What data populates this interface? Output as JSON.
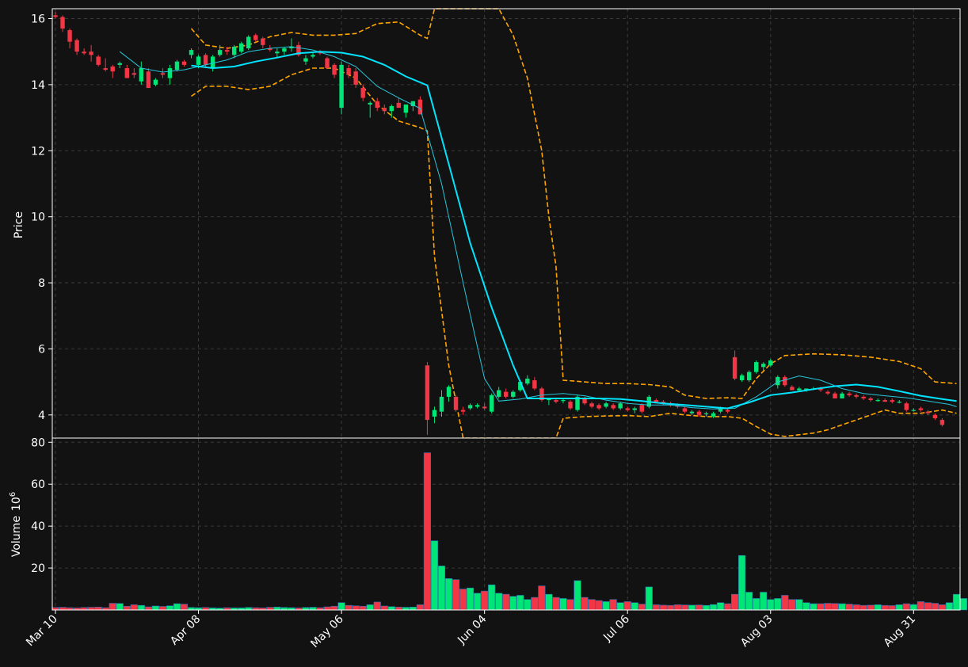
{
  "chart_data": {
    "type": "candlestick",
    "price_panel": {
      "ylabel": "Price",
      "ylim": [
        3.3,
        16.3
      ],
      "yticks": [
        "4",
        "6",
        "8",
        "10",
        "12",
        "14",
        "16"
      ],
      "grid": true
    },
    "volume_panel": {
      "ylabel": "Volume",
      "ylabel_exp": "10",
      "ylabel_sup": "6",
      "ylim": [
        0,
        82
      ],
      "yticks": [
        "20",
        "40",
        "60",
        "80"
      ],
      "grid": true
    },
    "x_range": [
      0,
      126.5
    ],
    "xticks": [
      {
        "label": "Mar 10",
        "index": 0
      },
      {
        "label": "Apr 08",
        "index": 20
      },
      {
        "label": "May 06",
        "index": 40
      },
      {
        "label": "Jun 04",
        "index": 60
      },
      {
        "label": "Jul 06",
        "index": 80
      },
      {
        "label": "Aug 03",
        "index": 100
      },
      {
        "label": "Aug 31",
        "index": 120
      }
    ],
    "colors": {
      "up": "#00e676",
      "down": "#f23645",
      "ma_fast": "#26c6da",
      "ma_slow": "#00e5ff",
      "band": "#ffa500",
      "background": "#121212",
      "grid": "#3a3a3a"
    },
    "candles": [
      [
        16.1,
        16.2,
        16.0,
        16.05
      ],
      [
        16.05,
        16.1,
        15.6,
        15.7
      ],
      [
        15.65,
        15.7,
        15.1,
        15.3
      ],
      [
        15.35,
        15.4,
        14.9,
        15.0
      ],
      [
        15.0,
        15.1,
        14.9,
        14.95
      ],
      [
        15.0,
        15.2,
        14.7,
        14.9
      ],
      [
        14.85,
        14.9,
        14.55,
        14.6
      ],
      [
        14.5,
        14.8,
        14.4,
        14.45
      ],
      [
        14.55,
        14.6,
        14.2,
        14.4
      ],
      [
        14.6,
        14.7,
        14.5,
        14.65
      ],
      [
        14.5,
        14.6,
        14.2,
        14.2
      ],
      [
        14.35,
        14.5,
        14.2,
        14.3
      ],
      [
        14.1,
        14.7,
        14.0,
        14.5
      ],
      [
        14.4,
        14.5,
        13.9,
        13.9
      ],
      [
        14.0,
        14.2,
        13.95,
        14.15
      ],
      [
        14.35,
        14.5,
        14.2,
        14.3
      ],
      [
        14.2,
        14.6,
        14.0,
        14.5
      ],
      [
        14.45,
        14.75,
        14.4,
        14.7
      ],
      [
        14.7,
        14.75,
        14.55,
        14.6
      ],
      [
        14.9,
        15.1,
        14.8,
        15.05
      ],
      [
        14.6,
        14.9,
        14.5,
        14.85
      ],
      [
        14.9,
        14.95,
        14.5,
        14.6
      ],
      [
        14.5,
        14.9,
        14.4,
        14.85
      ],
      [
        14.9,
        15.2,
        14.85,
        15.05
      ],
      [
        15.05,
        15.15,
        14.9,
        15.0
      ],
      [
        14.9,
        15.2,
        14.8,
        15.15
      ],
      [
        15.0,
        15.3,
        14.95,
        15.25
      ],
      [
        15.1,
        15.5,
        15.05,
        15.45
      ],
      [
        15.5,
        15.55,
        15.3,
        15.35
      ],
      [
        15.4,
        15.45,
        15.1,
        15.2
      ],
      [
        15.1,
        15.2,
        15.0,
        15.05
      ],
      [
        14.95,
        15.1,
        14.8,
        15.0
      ],
      [
        15.0,
        15.15,
        14.9,
        15.1
      ],
      [
        15.1,
        15.4,
        15.0,
        15.15
      ],
      [
        15.2,
        15.3,
        14.85,
        14.9
      ],
      [
        14.7,
        14.9,
        14.6,
        14.8
      ],
      [
        14.85,
        15.0,
        14.8,
        14.9
      ],
      [
        15.0,
        15.05,
        14.9,
        14.95
      ],
      [
        14.8,
        14.85,
        14.5,
        14.5
      ],
      [
        14.6,
        14.65,
        14.2,
        14.3
      ],
      [
        13.3,
        14.7,
        13.1,
        14.6
      ],
      [
        14.5,
        14.6,
        14.2,
        14.3
      ],
      [
        14.4,
        14.5,
        13.9,
        14.0
      ],
      [
        13.9,
        14.0,
        13.5,
        13.6
      ],
      [
        13.4,
        13.5,
        13.0,
        13.45
      ],
      [
        13.5,
        13.6,
        13.2,
        13.3
      ],
      [
        13.3,
        13.4,
        13.1,
        13.2
      ],
      [
        13.2,
        13.4,
        13.0,
        13.35
      ],
      [
        13.45,
        13.6,
        13.3,
        13.3
      ],
      [
        13.15,
        13.4,
        13.0,
        13.4
      ],
      [
        13.35,
        13.5,
        13.2,
        13.5
      ],
      [
        13.55,
        13.65,
        13.1,
        13.1
      ],
      [
        5.5,
        5.6,
        3.4,
        3.85
      ],
      [
        3.95,
        4.25,
        3.75,
        4.15
      ],
      [
        4.1,
        4.75,
        3.95,
        4.55
      ],
      [
        4.55,
        4.9,
        4.4,
        4.85
      ],
      [
        4.55,
        4.6,
        4.1,
        4.15
      ],
      [
        4.15,
        4.25,
        4.0,
        4.1
      ],
      [
        4.2,
        4.35,
        4.15,
        4.3
      ],
      [
        4.25,
        4.35,
        4.2,
        4.3
      ],
      [
        4.25,
        4.35,
        4.15,
        4.2
      ],
      [
        4.1,
        4.65,
        4.05,
        4.6
      ],
      [
        4.55,
        4.85,
        4.5,
        4.75
      ],
      [
        4.7,
        4.8,
        4.5,
        4.55
      ],
      [
        4.55,
        4.75,
        4.5,
        4.7
      ],
      [
        4.75,
        5.05,
        4.7,
        5.0
      ],
      [
        4.95,
        5.2,
        4.9,
        5.1
      ],
      [
        5.05,
        5.15,
        4.75,
        4.8
      ],
      [
        4.8,
        4.85,
        4.4,
        4.45
      ],
      [
        4.45,
        4.5,
        4.3,
        4.5
      ],
      [
        4.45,
        4.5,
        4.35,
        4.4
      ],
      [
        4.45,
        4.5,
        4.35,
        4.45
      ],
      [
        4.4,
        4.45,
        4.15,
        4.2
      ],
      [
        4.15,
        4.6,
        4.1,
        4.55
      ],
      [
        4.5,
        4.55,
        4.3,
        4.35
      ],
      [
        4.35,
        4.4,
        4.2,
        4.25
      ],
      [
        4.3,
        4.35,
        4.15,
        4.2
      ],
      [
        4.25,
        4.4,
        4.2,
        4.35
      ],
      [
        4.3,
        4.35,
        4.15,
        4.2
      ],
      [
        4.2,
        4.4,
        4.15,
        4.35
      ],
      [
        4.2,
        4.25,
        4.1,
        4.15
      ],
      [
        4.15,
        4.25,
        4.05,
        4.2
      ],
      [
        4.3,
        4.35,
        4.05,
        4.1
      ],
      [
        4.25,
        4.6,
        4.2,
        4.55
      ],
      [
        4.45,
        4.5,
        4.35,
        4.4
      ],
      [
        4.4,
        4.45,
        4.3,
        4.35
      ],
      [
        4.35,
        4.4,
        4.25,
        4.3
      ],
      [
        4.3,
        4.35,
        4.2,
        4.25
      ],
      [
        4.2,
        4.25,
        4.05,
        4.1
      ],
      [
        4.05,
        4.15,
        4.0,
        4.1
      ],
      [
        4.1,
        4.15,
        3.95,
        4.0
      ],
      [
        4.05,
        4.1,
        3.95,
        4.05
      ],
      [
        3.95,
        4.1,
        3.9,
        4.05
      ],
      [
        4.1,
        4.25,
        4.05,
        4.2
      ],
      [
        4.15,
        4.2,
        4.05,
        4.1
      ],
      [
        5.75,
        5.95,
        5.05,
        5.1
      ],
      [
        5.05,
        5.25,
        5.0,
        5.2
      ],
      [
        5.05,
        5.35,
        5.0,
        5.3
      ],
      [
        5.3,
        5.65,
        5.25,
        5.6
      ],
      [
        5.45,
        5.6,
        5.35,
        5.55
      ],
      [
        5.5,
        5.7,
        5.45,
        5.65
      ],
      [
        4.9,
        5.2,
        4.8,
        5.15
      ],
      [
        5.15,
        5.2,
        4.85,
        4.9
      ],
      [
        4.85,
        4.9,
        4.75,
        4.75
      ],
      [
        4.75,
        4.85,
        4.7,
        4.8
      ],
      [
        4.75,
        4.8,
        4.7,
        4.8
      ],
      [
        4.8,
        4.85,
        4.75,
        4.8
      ],
      [
        4.8,
        4.85,
        4.7,
        4.75
      ],
      [
        4.7,
        4.75,
        4.6,
        4.65
      ],
      [
        4.65,
        4.7,
        4.5,
        4.5
      ],
      [
        4.5,
        4.7,
        4.5,
        4.65
      ],
      [
        4.65,
        4.7,
        4.55,
        4.6
      ],
      [
        4.6,
        4.65,
        4.5,
        4.55
      ],
      [
        4.55,
        4.6,
        4.45,
        4.5
      ],
      [
        4.5,
        4.55,
        4.4,
        4.45
      ],
      [
        4.45,
        4.5,
        4.4,
        4.45
      ],
      [
        4.45,
        4.5,
        4.4,
        4.4
      ],
      [
        4.45,
        4.5,
        4.35,
        4.4
      ],
      [
        4.4,
        4.45,
        4.35,
        4.4
      ],
      [
        4.35,
        4.4,
        4.1,
        4.15
      ],
      [
        4.15,
        4.2,
        4.1,
        4.15
      ],
      [
        4.2,
        4.25,
        4.1,
        4.15
      ],
      [
        4.1,
        4.15,
        4.0,
        4.05
      ],
      [
        4.0,
        4.05,
        3.85,
        3.9
      ],
      [
        3.85,
        3.9,
        3.65,
        3.7
      ]
    ],
    "volume": [
      1.2,
      1.3,
      1.1,
      1.0,
      1.2,
      1.3,
      1.4,
      1.1,
      3.2,
      3.1,
      1.8,
      2.5,
      2.2,
      1.5,
      1.9,
      1.7,
      2.0,
      3.0,
      2.8,
      1.2,
      1.1,
      1.2,
      1.0,
      0.9,
      1.1,
      1.0,
      1.0,
      1.2,
      1.1,
      1.0,
      1.3,
      1.4,
      1.2,
      1.1,
      1.0,
      1.2,
      1.3,
      1.1,
      1.5,
      1.8,
      3.5,
      2.2,
      2.0,
      1.8,
      2.5,
      3.8,
      1.9,
      1.6,
      1.4,
      1.3,
      1.4,
      2.5,
      75.0,
      33.0,
      21.0,
      15.0,
      14.5,
      10.0,
      10.5,
      8.0,
      9.0,
      12.0,
      8.0,
      7.5,
      6.5,
      7.0,
      5.0,
      6.0,
      11.5,
      7.5,
      6.0,
      5.5,
      5.0,
      14.0,
      6.0,
      5.0,
      4.5,
      4.0,
      5.0,
      3.5,
      4.0,
      3.5,
      2.8,
      11.0,
      2.5,
      2.3,
      2.2,
      2.5,
      2.4,
      2.3,
      2.4,
      2.2,
      2.6,
      3.5,
      3.0,
      7.5,
      26.0,
      8.5,
      5.5,
      8.5,
      5.0,
      5.5,
      7.0,
      5.0,
      5.0,
      3.5,
      3.0,
      3.0,
      3.2,
      3.1,
      3.0,
      2.8,
      2.5,
      2.2,
      2.3,
      2.5,
      2.2,
      2.1,
      2.5,
      3.0,
      2.6,
      4.0,
      3.5,
      3.2,
      2.5,
      3.5,
      7.5,
      5.5
    ],
    "ma_fast": [
      [
        9,
        15.0
      ],
      [
        12,
        14.5
      ],
      [
        15,
        14.38
      ],
      [
        18,
        14.45
      ],
      [
        21,
        14.6
      ],
      [
        24,
        14.75
      ],
      [
        27,
        15.0
      ],
      [
        30,
        15.1
      ],
      [
        33,
        15.15
      ],
      [
        36,
        15.05
      ],
      [
        39,
        14.85
      ],
      [
        42,
        14.55
      ],
      [
        45,
        13.95
      ],
      [
        48,
        13.6
      ],
      [
        51,
        13.28
      ],
      [
        54,
        11.0
      ],
      [
        57,
        8.0
      ],
      [
        60,
        5.1
      ],
      [
        62,
        4.42
      ],
      [
        65,
        4.48
      ],
      [
        68,
        4.6
      ],
      [
        71,
        4.65
      ],
      [
        74,
        4.58
      ],
      [
        77,
        4.45
      ],
      [
        80,
        4.35
      ],
      [
        83,
        4.3
      ],
      [
        86,
        4.3
      ],
      [
        89,
        4.22
      ],
      [
        92,
        4.18
      ],
      [
        95,
        4.2
      ],
      [
        98,
        4.55
      ],
      [
        101,
        5.0
      ],
      [
        104,
        5.18
      ],
      [
        107,
        5.05
      ],
      [
        110,
        4.8
      ],
      [
        113,
        4.65
      ],
      [
        116,
        4.58
      ],
      [
        119,
        4.52
      ],
      [
        122,
        4.42
      ],
      [
        125,
        4.32
      ],
      [
        126,
        4.25
      ]
    ],
    "ma_slow": [
      [
        19,
        14.58
      ],
      [
        22,
        14.5
      ],
      [
        25,
        14.55
      ],
      [
        28,
        14.7
      ],
      [
        31,
        14.82
      ],
      [
        34,
        14.95
      ],
      [
        37,
        15.0
      ],
      [
        40,
        14.97
      ],
      [
        43,
        14.85
      ],
      [
        46,
        14.6
      ],
      [
        49,
        14.25
      ],
      [
        52,
        13.98
      ],
      [
        55,
        11.6
      ],
      [
        58,
        9.2
      ],
      [
        61,
        7.25
      ],
      [
        64,
        5.5
      ],
      [
        66,
        4.5
      ],
      [
        70,
        4.5
      ],
      [
        73,
        4.5
      ],
      [
        76,
        4.5
      ],
      [
        79,
        4.48
      ],
      [
        82,
        4.42
      ],
      [
        85,
        4.35
      ],
      [
        88,
        4.3
      ],
      [
        91,
        4.25
      ],
      [
        94,
        4.2
      ],
      [
        97,
        4.38
      ],
      [
        100,
        4.6
      ],
      [
        103,
        4.68
      ],
      [
        106,
        4.78
      ],
      [
        109,
        4.87
      ],
      [
        112,
        4.92
      ],
      [
        115,
        4.85
      ],
      [
        118,
        4.72
      ],
      [
        121,
        4.58
      ],
      [
        124,
        4.48
      ],
      [
        126,
        4.42
      ]
    ],
    "band_upper": [
      [
        19,
        15.7
      ],
      [
        21,
        15.2
      ],
      [
        24,
        15.1
      ],
      [
        27,
        15.2
      ],
      [
        30,
        15.45
      ],
      [
        33,
        15.58
      ],
      [
        36,
        15.5
      ],
      [
        39,
        15.5
      ],
      [
        42,
        15.55
      ],
      [
        45,
        15.85
      ],
      [
        48,
        15.9
      ],
      [
        51,
        15.5
      ],
      [
        52,
        15.4
      ],
      [
        53,
        16.3
      ],
      [
        62,
        16.3
      ],
      [
        64,
        15.5
      ],
      [
        66,
        14.2
      ],
      [
        68,
        12.0
      ],
      [
        69,
        10.0
      ],
      [
        70,
        8.5
      ],
      [
        71,
        5.05
      ],
      [
        74,
        5.0
      ],
      [
        77,
        4.95
      ],
      [
        80,
        4.95
      ],
      [
        83,
        4.92
      ],
      [
        86,
        4.85
      ],
      [
        88,
        4.6
      ],
      [
        91,
        4.5
      ],
      [
        94,
        4.52
      ],
      [
        96,
        4.5
      ],
      [
        98,
        5.1
      ],
      [
        100,
        5.55
      ],
      [
        102,
        5.8
      ],
      [
        106,
        5.85
      ],
      [
        110,
        5.82
      ],
      [
        114,
        5.75
      ],
      [
        118,
        5.62
      ],
      [
        121,
        5.4
      ],
      [
        123,
        5.0
      ],
      [
        126,
        4.95
      ]
    ],
    "band_lower": [
      [
        19,
        13.65
      ],
      [
        21,
        13.95
      ],
      [
        24,
        13.95
      ],
      [
        27,
        13.85
      ],
      [
        30,
        13.95
      ],
      [
        33,
        14.3
      ],
      [
        36,
        14.5
      ],
      [
        39,
        14.5
      ],
      [
        42,
        14.2
      ],
      [
        45,
        13.4
      ],
      [
        48,
        12.9
      ],
      [
        51,
        12.7
      ],
      [
        52,
        12.6
      ],
      [
        53,
        8.8
      ],
      [
        55,
        5.5
      ],
      [
        57,
        3.3
      ],
      [
        70,
        3.3
      ],
      [
        71,
        3.9
      ],
      [
        74,
        3.95
      ],
      [
        77,
        3.97
      ],
      [
        80,
        3.98
      ],
      [
        83,
        3.95
      ],
      [
        86,
        4.05
      ],
      [
        88,
        4.0
      ],
      [
        91,
        3.95
      ],
      [
        94,
        3.95
      ],
      [
        96,
        3.9
      ],
      [
        98,
        3.65
      ],
      [
        100,
        3.42
      ],
      [
        102,
        3.35
      ],
      [
        104,
        3.4
      ],
      [
        106,
        3.45
      ],
      [
        108,
        3.55
      ],
      [
        110,
        3.7
      ],
      [
        112,
        3.85
      ],
      [
        114,
        4.0
      ],
      [
        116,
        4.15
      ],
      [
        118,
        4.05
      ],
      [
        121,
        4.05
      ],
      [
        124,
        4.15
      ],
      [
        126,
        4.05
      ]
    ]
  }
}
